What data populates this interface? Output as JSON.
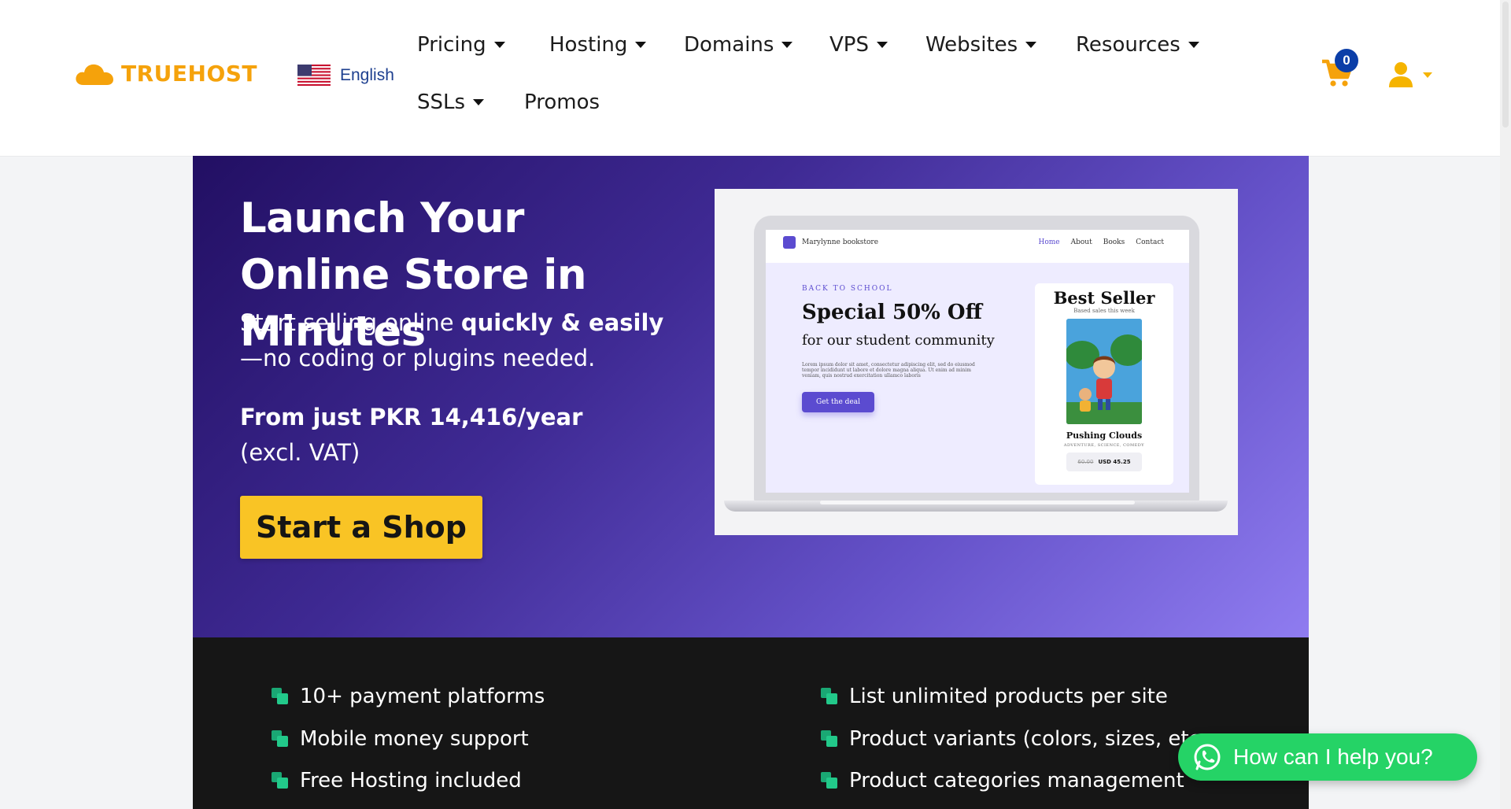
{
  "header": {
    "brand": "TRUEHOST",
    "language": "English",
    "nav": [
      {
        "label": "Pricing"
      },
      {
        "label": "Hosting"
      },
      {
        "label": "Domains"
      },
      {
        "label": "VPS"
      },
      {
        "label": "Websites"
      },
      {
        "label": "Resources"
      },
      {
        "label": "SSLs"
      },
      {
        "label": "Promos"
      }
    ],
    "cart_count": "0"
  },
  "hero": {
    "title": "Launch Your Online Store in Minutes",
    "subtitle_start": "Start selling online ",
    "subtitle_bold": "quickly & easily",
    "subtitle_end": "—no coding or plugins needed.",
    "price_bold": "From just PKR 14,416/year",
    "price_rest": " (excl. VAT)",
    "cta_label": "Start a Shop"
  },
  "mockup": {
    "site_name": "Marylynne bookstore",
    "links": [
      "Home",
      "About",
      "Books",
      "Contact"
    ],
    "eyebrow": "BACK TO SCHOOL",
    "headline": "Special 50% Off",
    "subheadline": "for our student community",
    "lorem": "Lorem ipsum dolor sit amet, consectetur adipiscing elit, sed do eiusmod tempor incididunt ut labore et dolore magna aliqua. Ut enim ad minim veniam, quis nostrud exercitation ullamco laboris",
    "button": "Get the deal",
    "best_seller_title": "Best Seller",
    "best_seller_sub": "Based sales this week",
    "book_name": "Pushing Clouds",
    "book_tags": "ADVENTURE, SCIENCE, COMEDY",
    "old_price": "60.00",
    "new_price": "USD 45.25"
  },
  "features": {
    "left": [
      "10+ payment platforms",
      "Mobile money support",
      "Free Hosting included"
    ],
    "right": [
      "List unlimited products per site",
      "Product variants (colors, sizes, etc",
      "Product categories management"
    ]
  },
  "whatsapp": {
    "label": "How can I help you?"
  },
  "colors": {
    "brand": "#f5a20b",
    "cta": "#f9c425",
    "whatsapp": "#25d366",
    "feature_icon": "#22c98a"
  }
}
